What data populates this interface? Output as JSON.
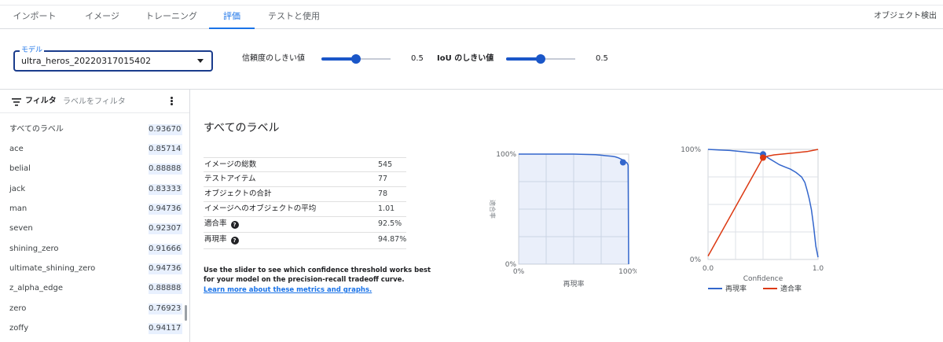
{
  "tabs": [
    {
      "label": "インポート"
    },
    {
      "label": "イメージ"
    },
    {
      "label": "トレーニング"
    },
    {
      "label": "評価"
    },
    {
      "label": "テストと使用"
    }
  ],
  "top_right": "オブジェクト検出",
  "model": {
    "label": "モデル",
    "value": "ultra_heros_20220317015402"
  },
  "sliders": [
    {
      "label": "信頼度のしきい値",
      "value": "0.5",
      "level": 0.5
    },
    {
      "label": "IoU のしきい値",
      "value": "0.5",
      "level": 0.5
    }
  ],
  "filter": {
    "title": "フィルタ",
    "placeholder": "ラベルをフィルタ"
  },
  "labels": [
    {
      "name": "すべてのラベル",
      "score": "0.93670"
    },
    {
      "name": "ace",
      "score": "0.85714"
    },
    {
      "name": "belial",
      "score": "0.88888"
    },
    {
      "name": "jack",
      "score": "0.83333"
    },
    {
      "name": "man",
      "score": "0.94736"
    },
    {
      "name": "seven",
      "score": "0.92307"
    },
    {
      "name": "shining_zero",
      "score": "0.91666"
    },
    {
      "name": "ultimate_shining_zero",
      "score": "0.94736"
    },
    {
      "name": "z_alpha_edge",
      "score": "0.88888"
    },
    {
      "name": "zero",
      "score": "0.76923"
    },
    {
      "name": "zoffy",
      "score": "0.94117"
    }
  ],
  "panel": {
    "title": "すべてのラベル",
    "stats": [
      {
        "key": "イメージの総数",
        "value": "545"
      },
      {
        "key": "テストアイテム",
        "value": "77"
      },
      {
        "key": "オブジェクトの合計",
        "value": "78"
      },
      {
        "key": "イメージへのオブジェクトの平均",
        "value": "1.01"
      },
      {
        "key": "適合率",
        "value": "92.5%",
        "help": "?"
      },
      {
        "key": "再現率",
        "value": "94.87%",
        "help": "?"
      }
    ],
    "note": "Use the slider to see which confidence threshold works best for your model on the precision-recall tradeoff curve.",
    "link": "Learn more about these metrics and graphs."
  },
  "colors": {
    "accent": "#1a73e8",
    "recall": "#3366cc",
    "precision": "#dc3912"
  },
  "chart_data": [
    {
      "type": "area",
      "xlabel": "再現率",
      "ylabel": "適合率",
      "xticks": [
        "0%",
        "100%"
      ],
      "yticks": [
        "0%",
        "100%"
      ],
      "xlim": [
        0,
        1
      ],
      "ylim": [
        0,
        1
      ],
      "x": [
        0,
        0.5,
        0.7,
        0.75,
        0.8,
        0.85,
        0.88,
        0.91,
        0.93,
        0.95,
        0.97,
        0.985,
        0.99,
        0.995,
        1.0
      ],
      "y": [
        1.0,
        1.0,
        0.995,
        0.99,
        0.985,
        0.98,
        0.975,
        0.965,
        0.955,
        0.945,
        0.93,
        0.92,
        0.91,
        0.9,
        0.0
      ],
      "marker": {
        "x": 0.9487,
        "y": 0.925
      }
    },
    {
      "type": "line",
      "xlabel": "Confidence",
      "xticks": [
        "0.0",
        "1.0"
      ],
      "yticks": [
        "0%",
        "100%"
      ],
      "xlim": [
        0,
        1
      ],
      "ylim": [
        0,
        1
      ],
      "series": [
        {
          "name": "再現率",
          "color": "#3366cc",
          "x": [
            0,
            0.1,
            0.2,
            0.3,
            0.4,
            0.45,
            0.5,
            0.55,
            0.6,
            0.65,
            0.7,
            0.75,
            0.8,
            0.85,
            0.88,
            0.9,
            0.92,
            0.94,
            0.96,
            0.98,
            1.0
          ],
          "y": [
            1.0,
            0.995,
            0.99,
            0.98,
            0.97,
            0.965,
            0.955,
            0.92,
            0.89,
            0.86,
            0.84,
            0.82,
            0.79,
            0.75,
            0.7,
            0.63,
            0.55,
            0.45,
            0.3,
            0.12,
            0.02
          ]
        },
        {
          "name": "適合率",
          "color": "#dc3912",
          "x": [
            0,
            0.5,
            0.55,
            0.6,
            0.7,
            0.8,
            0.9,
            0.95,
            1.0
          ],
          "y": [
            0.03,
            0.925,
            0.94,
            0.95,
            0.96,
            0.97,
            0.98,
            0.99,
            1.0
          ]
        }
      ],
      "markers": [
        {
          "series": "再現率",
          "x": 0.5,
          "y": 0.955
        },
        {
          "series": "適合率",
          "x": 0.5,
          "y": 0.925
        }
      ]
    }
  ]
}
